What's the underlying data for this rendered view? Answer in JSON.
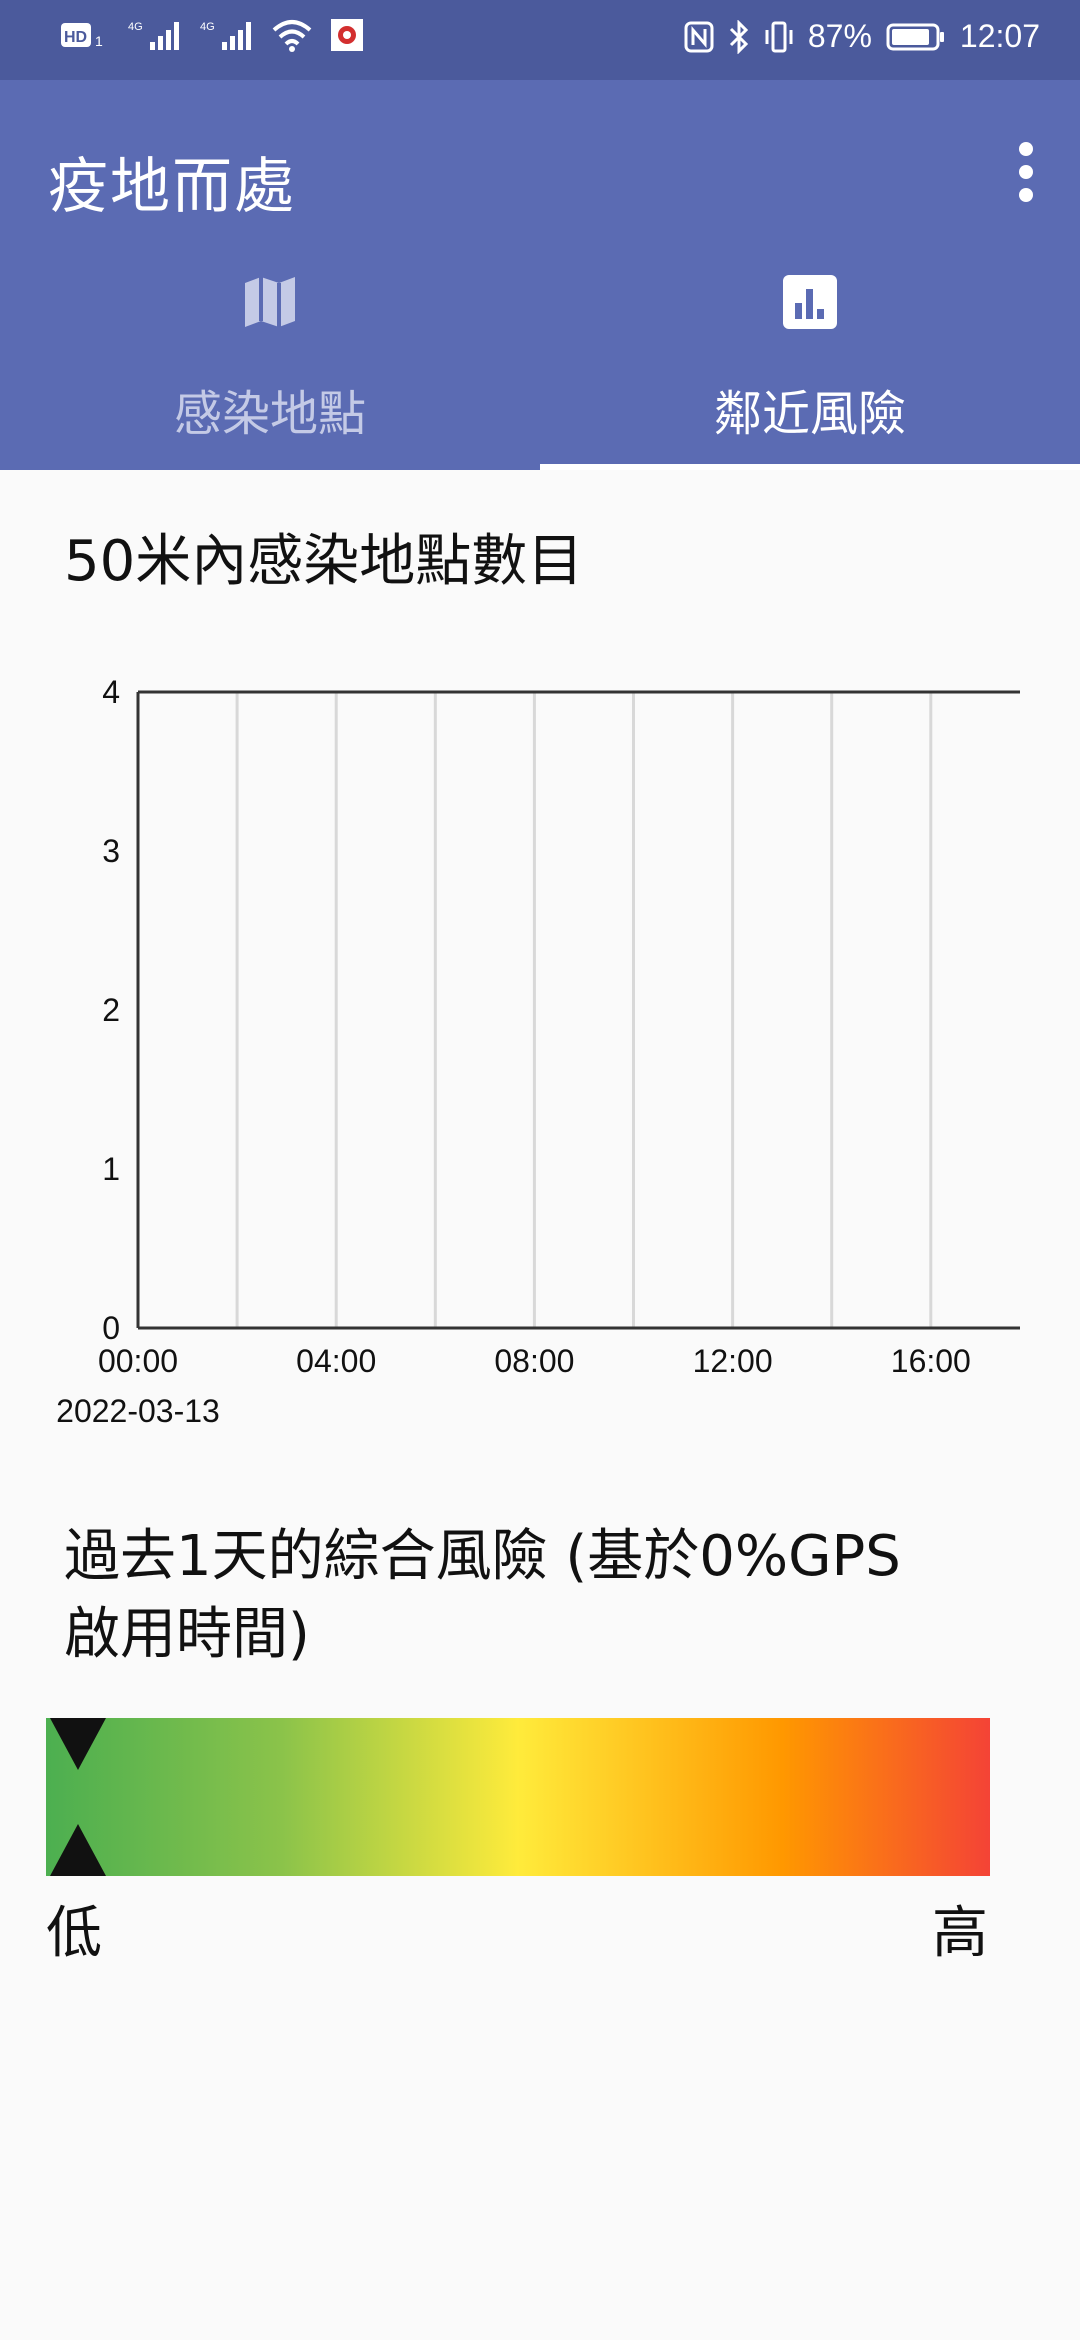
{
  "status_bar": {
    "battery": "87%",
    "time": "12:07",
    "left_icons": [
      "hd-icon",
      "signal-4g-icon",
      "signal-4g-icon",
      "wifi-icon",
      "app-notification-icon"
    ],
    "right_icons": [
      "nfc-icon",
      "bluetooth-icon",
      "vibrate-icon",
      "battery-icon"
    ]
  },
  "app_bar": {
    "title": "疫地而處",
    "menu_icon": "more-vertical-icon"
  },
  "tabs": [
    {
      "label": "感染地點",
      "icon": "map-icon",
      "active": false
    },
    {
      "label": "鄰近風險",
      "icon": "bar-chart-icon",
      "active": true
    }
  ],
  "chart_section": {
    "title": "50米內感染地點數目"
  },
  "chart_data": {
    "type": "line",
    "title": "50米內感染地點數目",
    "xlabel": "",
    "ylabel": "",
    "x_tick_labels": [
      "00:00",
      "04:00",
      "08:00",
      "12:00",
      "16:00"
    ],
    "x_start_date": "2022-03-13",
    "y_ticks": [
      "0",
      "1",
      "2",
      "3",
      "4"
    ],
    "ylim": [
      0,
      4
    ],
    "grid": true,
    "series": []
  },
  "risk_section": {
    "title_line1": "過去1天的綜合風險 (基於0%GPS",
    "title_line2": "啟用時間)",
    "low_label": "低",
    "high_label": "高",
    "level": 0,
    "colors": [
      "#4caf50",
      "#ffeb3b",
      "#f44336"
    ]
  }
}
